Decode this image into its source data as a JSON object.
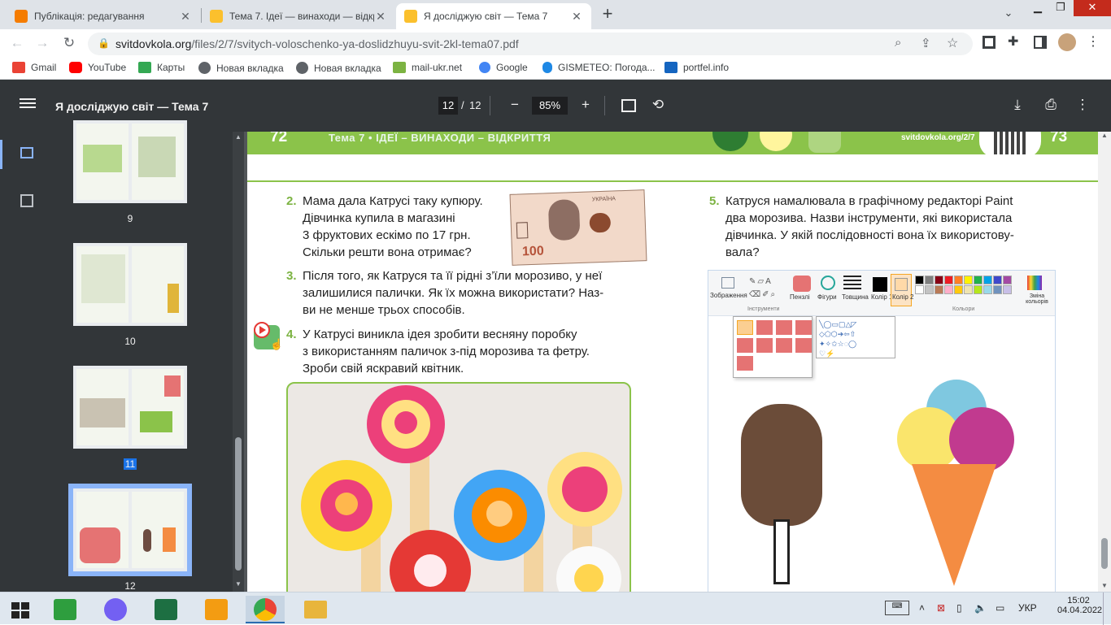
{
  "browser": {
    "tabs": [
      {
        "title": "Публікація: редагування"
      },
      {
        "title": "Тема 7. Ідеї — винаходи — відкр"
      },
      {
        "title": "Я досліджую світ — Тема 7"
      }
    ],
    "new_tab": "+",
    "url_domain": "svitdovkola.org",
    "url_path": "/files/2/7/svitych-voloschenko-ya-doslidzhuyu-svit-2kl-tema07.pdf"
  },
  "bookmarks": [
    {
      "label": "Gmail",
      "icon": "gmail-icon",
      "color": "#ea4335"
    },
    {
      "label": "YouTube",
      "icon": "youtube-icon",
      "color": "#ff0000"
    },
    {
      "label": "Карты",
      "icon": "maps-icon",
      "color": "#34a853"
    },
    {
      "label": "Новая вкладка",
      "icon": "globe-icon",
      "color": "#5f6368"
    },
    {
      "label": "Новая вкладка",
      "icon": "globe-icon",
      "color": "#5f6368"
    },
    {
      "label": "mail-ukr.net",
      "icon": "mail-icon",
      "color": "#7cb342"
    },
    {
      "label": "Google",
      "icon": "google-icon",
      "color": "#4285f4"
    },
    {
      "label": "GISMETEO: Погода...",
      "icon": "weather-icon",
      "color": "#1e88e5"
    },
    {
      "label": "portfel.info",
      "icon": "briefcase-icon",
      "color": "#1565c0"
    }
  ],
  "pdf": {
    "title": "Я досліджую світ — Тема 7",
    "current_page": "12",
    "separator": "/",
    "total_pages": "12",
    "zoom": "85%"
  },
  "thumbnails": [
    {
      "label": "9",
      "selected": false
    },
    {
      "label": "10",
      "selected": false
    },
    {
      "label": "11",
      "selected": false
    },
    {
      "label": "12",
      "selected": true
    }
  ],
  "document": {
    "left_page_number": "72",
    "band_title": "Тема 7 • ІДЕЇ – ВИНАХОДИ – ВІДКРИТТЯ",
    "site_link": "svitdovkola.org/2/7",
    "right_page_number": "73",
    "tasks": [
      {
        "num": "2.",
        "lines": [
          "Мама дала Катрусі таку купюру.",
          "Дівчинка купила в магазині",
          "3 фруктових ескімо по 17 грн.",
          "Скільки решти вона отримає?"
        ]
      },
      {
        "num": "3.",
        "lines": [
          "Після того, як Катруся та її рідні з’їли морозиво, у неї",
          "залишилися палички. Як їх можна використати? Наз-",
          "ви не менше трьох способів."
        ]
      },
      {
        "num": "4.",
        "lines": [
          "У Катрусі виникла ідея зробити весняну поробку",
          "з використанням паличок з-під морозива та фетру.",
          "Зроби свій яскравий квітник."
        ]
      },
      {
        "num": "5.",
        "lines": [
          "Катруся намалювала в графічному редакторі Paint",
          "два морозива. Назви інструменти, які використала",
          "дівчинка. У якій послідовності вона їх використову-",
          "вала?"
        ]
      }
    ],
    "banknote_country": "УКРАЇНА",
    "banknote_value": "100",
    "paint": {
      "image_label": "Зображення",
      "tools_label": "Інструменти",
      "brushes_label": "Пензлі",
      "shapes_label": "Фігури",
      "size_label": "Товщина",
      "color1_label": "Колір 1",
      "color2_label": "Колір 2",
      "colors_label": "Кольори",
      "edit_colors_label": "Зміна кольорів",
      "palette": [
        "#000000",
        "#7f7f7f",
        "#880015",
        "#ed1c24",
        "#ff7f27",
        "#fff200",
        "#22b14c",
        "#00a2e8",
        "#3f48cc",
        "#a349a4",
        "#ffffff",
        "#c3c3c3",
        "#b97a57",
        "#ffaec9",
        "#ffc90e",
        "#efe4b0",
        "#b5e61d",
        "#99d9ea",
        "#7092be",
        "#c8bfe7"
      ]
    }
  },
  "taskbar": {
    "language": "УКР",
    "time": "15:02",
    "date": "04.04.2022"
  }
}
